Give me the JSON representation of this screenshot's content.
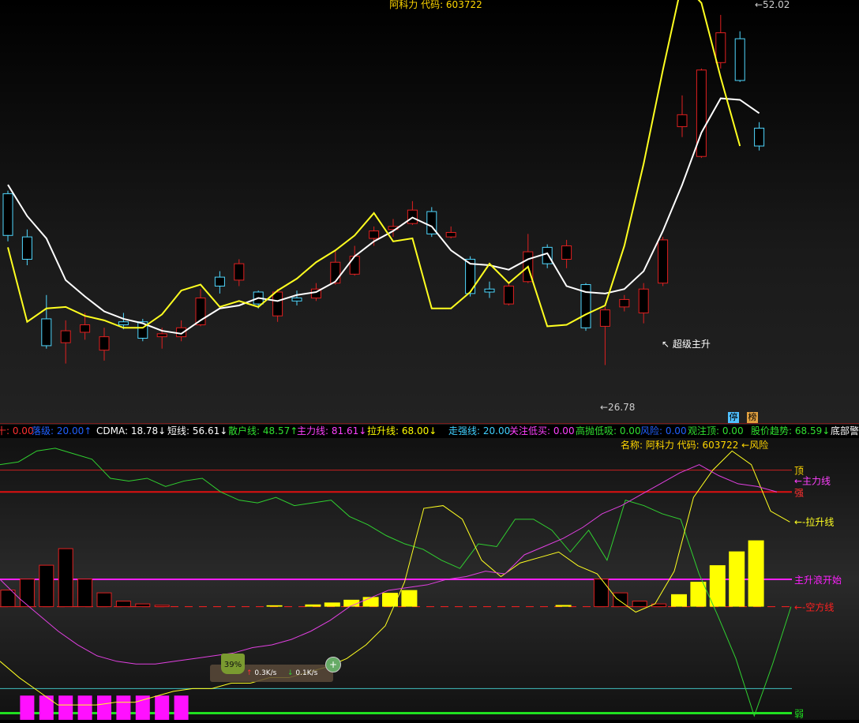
{
  "chart_data": [
    {
      "type": "candlestick",
      "title": "阿科力 代码: 603722",
      "ylim": [
        24.5,
        53
      ],
      "candles": [
        {
          "o": 37.2,
          "c": 40.0,
          "h": 40.2,
          "l": 36.8,
          "up": false
        },
        {
          "o": 35.6,
          "c": 37.1,
          "h": 37.6,
          "l": 35.2,
          "up": false
        },
        {
          "o": 31.6,
          "c": 29.8,
          "h": 33.2,
          "l": 29.6,
          "up": false
        },
        {
          "o": 30.0,
          "c": 30.8,
          "h": 31.5,
          "l": 28.6,
          "up": true
        },
        {
          "o": 30.7,
          "c": 31.2,
          "h": 32.0,
          "l": 30.2,
          "up": true
        },
        {
          "o": 29.5,
          "c": 30.4,
          "h": 31.0,
          "l": 28.8,
          "up": true
        },
        {
          "o": 31.2,
          "c": 31.4,
          "h": 32.0,
          "l": 30.9,
          "up": false
        },
        {
          "o": 31.4,
          "c": 30.3,
          "h": 31.6,
          "l": 30.1,
          "up": false
        },
        {
          "o": 30.4,
          "c": 30.6,
          "h": 31.0,
          "l": 29.6,
          "up": true
        },
        {
          "o": 30.4,
          "c": 31.0,
          "h": 31.5,
          "l": 30.1,
          "up": true
        },
        {
          "o": 31.2,
          "c": 33.0,
          "h": 33.6,
          "l": 31.1,
          "up": true
        },
        {
          "o": 34.4,
          "c": 33.8,
          "h": 34.8,
          "l": 33.3,
          "up": false
        },
        {
          "o": 34.2,
          "c": 35.3,
          "h": 35.6,
          "l": 33.8,
          "up": true
        },
        {
          "o": 33.4,
          "c": 32.6,
          "h": 33.5,
          "l": 32.3,
          "up": false
        },
        {
          "o": 31.8,
          "c": 33.4,
          "h": 33.6,
          "l": 31.4,
          "up": true
        },
        {
          "o": 33.0,
          "c": 32.8,
          "h": 33.5,
          "l": 32.5,
          "up": false
        },
        {
          "o": 33.0,
          "c": 33.6,
          "h": 34.0,
          "l": 32.8,
          "up": true
        },
        {
          "o": 34.0,
          "c": 35.4,
          "h": 36.2,
          "l": 33.9,
          "up": true
        },
        {
          "o": 34.6,
          "c": 35.8,
          "h": 36.5,
          "l": 34.5,
          "up": true
        },
        {
          "o": 37.0,
          "c": 37.5,
          "h": 37.8,
          "l": 36.5,
          "up": true
        },
        {
          "o": 37.6,
          "c": 37.8,
          "h": 38.3,
          "l": 37.1,
          "up": true
        },
        {
          "o": 38.0,
          "c": 38.9,
          "h": 39.5,
          "l": 37.9,
          "up": true
        },
        {
          "o": 38.8,
          "c": 37.3,
          "h": 39.1,
          "l": 37.1,
          "up": false
        },
        {
          "o": 37.1,
          "c": 37.4,
          "h": 37.8,
          "l": 37.0,
          "up": true
        },
        {
          "o": 35.6,
          "c": 33.3,
          "h": 35.8,
          "l": 33.1,
          "up": false
        },
        {
          "o": 33.4,
          "c": 33.6,
          "h": 34.1,
          "l": 33.0,
          "up": false
        },
        {
          "o": 32.6,
          "c": 33.8,
          "h": 34.1,
          "l": 32.5,
          "up": true
        },
        {
          "o": 34.1,
          "c": 36.1,
          "h": 37.3,
          "l": 34.0,
          "up": true
        },
        {
          "o": 36.4,
          "c": 35.3,
          "h": 36.6,
          "l": 35.0,
          "up": false
        },
        {
          "o": 35.6,
          "c": 36.5,
          "h": 36.9,
          "l": 35.0,
          "up": true
        },
        {
          "o": 33.9,
          "c": 31.0,
          "h": 34.0,
          "l": 30.8,
          "up": false
        },
        {
          "o": 31.1,
          "c": 32.2,
          "h": 32.4,
          "l": 28.5,
          "up": true
        },
        {
          "o": 32.4,
          "c": 32.9,
          "h": 33.2,
          "l": 32.1,
          "up": true
        },
        {
          "o": 32.0,
          "c": 33.6,
          "h": 34.0,
          "l": 31.3,
          "up": true
        },
        {
          "o": 34.0,
          "c": 36.9,
          "h": 37.1,
          "l": 33.8,
          "up": true
        },
        {
          "o": 44.5,
          "c": 45.3,
          "h": 46.6,
          "l": 43.8,
          "up": true
        },
        {
          "o": 42.5,
          "c": 48.3,
          "h": 48.4,
          "l": 42.4,
          "up": true
        },
        {
          "o": 50.8,
          "c": 48.8,
          "h": 52.0,
          "l": 48.4,
          "up": true
        },
        {
          "o": 47.6,
          "c": 50.4,
          "h": 50.9,
          "l": 47.5,
          "up": false
        },
        {
          "o": 44.4,
          "c": 43.2,
          "h": 44.8,
          "l": 42.9,
          "up": false
        }
      ],
      "ma_yellow": [
        36.4,
        31.4,
        32.3,
        32.4,
        31.8,
        31.5,
        31.0,
        31.0,
        31.9,
        33.5,
        33.9,
        32.4,
        32.8,
        32.4,
        33.5,
        34.3,
        35.4,
        36.2,
        37.2,
        38.7,
        36.8,
        37.0,
        32.3,
        32.3,
        33.4,
        35.3,
        34.0,
        35.1,
        31.1,
        31.2,
        31.9,
        32.5,
        36.5,
        42.0,
        48.3,
        54.2,
        52.8,
        47.8,
        43.2
      ],
      "ma_white": [
        40.6,
        38.5,
        37.0,
        34.2,
        33.1,
        32.1,
        31.6,
        31.3,
        30.8,
        30.6,
        31.5,
        32.3,
        32.5,
        33.0,
        32.8,
        33.2,
        33.4,
        34.1,
        35.8,
        36.8,
        37.5,
        38.4,
        37.8,
        36.2,
        35.3,
        35.2,
        34.9,
        35.6,
        36.0,
        33.8,
        33.4,
        33.3,
        33.6,
        34.8,
        37.5,
        40.6,
        44.1,
        46.4,
        46.3,
        45.4
      ],
      "annotations": {
        "high_label": "52.02",
        "low_label": "26.78",
        "signal_label": "超级主升"
      },
      "labels": {
        "stop": "停",
        "list": "榜"
      }
    },
    {
      "type": "indicator",
      "title": "名称: 阿科力 代码: 603722 ←风险",
      "ylim": [
        0,
        100
      ],
      "hlines": [
        {
          "name": "顶",
          "level": 90,
          "color": "#c82020"
        },
        {
          "name": "强",
          "level": 82,
          "color": "#e01010"
        },
        {
          "name": "主升浪开始",
          "level": 50,
          "color": "#ff20ff"
        },
        {
          "name": "空方线",
          "level": 40,
          "color": "#ff2020"
        },
        {
          "name": "",
          "level": 10,
          "color": "#40c0c0"
        },
        {
          "name": "弱",
          "level": 1,
          "color": "#20e020"
        }
      ],
      "line_labels": {
        "main": "主力线",
        "pull": "拉升线"
      },
      "bars_dark": [
        6,
        10,
        15,
        21,
        10,
        5,
        2,
        1,
        0.5
      ],
      "bars_dark_idx": [
        0,
        1,
        2,
        3,
        4,
        5,
        6,
        7,
        8
      ],
      "bars_dark2": [
        {
          "i": 31,
          "v": 10
        },
        {
          "i": 32,
          "v": 5
        },
        {
          "i": 33,
          "v": 2
        },
        {
          "i": 34,
          "v": 1
        }
      ],
      "bars_yellow": [
        {
          "i": 14,
          "v": 0.5
        },
        {
          "i": 16,
          "v": 0.8
        },
        {
          "i": 17,
          "v": 1.5
        },
        {
          "i": 18,
          "v": 2.5
        },
        {
          "i": 19,
          "v": 3.5
        },
        {
          "i": 20,
          "v": 5
        },
        {
          "i": 21,
          "v": 6
        },
        {
          "i": 29,
          "v": 0.6
        },
        {
          "i": 35,
          "v": 4.5
        },
        {
          "i": 36,
          "v": 9
        },
        {
          "i": 37,
          "v": 15
        },
        {
          "i": 38,
          "v": 20
        },
        {
          "i": 39,
          "v": 24
        }
      ],
      "bars_magenta": [
        {
          "i": 1,
          "v": 7
        },
        {
          "i": 2,
          "v": 7
        },
        {
          "i": 3,
          "v": 7
        },
        {
          "i": 4,
          "v": 7
        },
        {
          "i": 5,
          "v": 7
        },
        {
          "i": 6,
          "v": 7
        },
        {
          "i": 7,
          "v": 7
        },
        {
          "i": 8,
          "v": 7
        },
        {
          "i": 9,
          "v": 7
        }
      ],
      "green_line": [
        92,
        93,
        97,
        98,
        96,
        94,
        87,
        86,
        87,
        84,
        86,
        87,
        82,
        79,
        78,
        80,
        77,
        78,
        79,
        73,
        70,
        66,
        63,
        61,
        57,
        54,
        63,
        62,
        72,
        72,
        68,
        60,
        68,
        57,
        79,
        77,
        74,
        72,
        52,
        37,
        21,
        0,
        19,
        40
      ],
      "yellow_line": [
        20,
        14,
        9,
        4,
        4,
        4,
        5,
        5,
        7,
        9,
        10,
        10,
        12,
        12,
        14,
        14,
        16,
        18,
        21,
        26,
        33,
        49,
        76,
        77,
        72,
        57,
        51,
        56,
        58,
        60,
        55,
        52,
        43,
        38,
        41,
        53,
        80,
        90,
        97,
        92,
        75,
        71
      ],
      "magenta_line": [
        50,
        43,
        37,
        31,
        26,
        22,
        20,
        19,
        19,
        20,
        21,
        22,
        23,
        25,
        26,
        28,
        31,
        35,
        40,
        43,
        46,
        47,
        48,
        50,
        51,
        53,
        52,
        59,
        62,
        65,
        69,
        74,
        77,
        81,
        85,
        89,
        92,
        88,
        85,
        84,
        82
      ]
    }
  ],
  "status": [
    {
      "text": "十: 0.00",
      "color": "#ff3030"
    },
    {
      "text": "落级: 20.00↑",
      "color": "#2060ff"
    },
    {
      "text": "CDMA: 18.78↓",
      "color": "#ffffff"
    },
    {
      "text": "短线: 56.61↓",
      "color": "#ffffff"
    },
    {
      "text": "散户线: 48.57↑",
      "color": "#30e030"
    },
    {
      "text": "主力线: 81.61↓",
      "color": "#ff40ff"
    },
    {
      "text": "拉升线: 68.00↓",
      "color": "#ffff00"
    },
    {
      "text": "走强线: 20.00",
      "color": "#40d0ff"
    },
    {
      "text": "关注低买: 0.00",
      "color": "#ff40ff"
    },
    {
      "text": "高抛低吸: 0.00",
      "color": "#30e030"
    },
    {
      "text": "风险: 0.00",
      "color": "#2060ff"
    },
    {
      "text": "观注顶: 0.00",
      "color": "#30e030"
    },
    {
      "text": "股价趋势: 68.59↓",
      "color": "#30e030"
    },
    {
      "text": "底部警",
      "color": "#ffffff"
    }
  ],
  "net_widget": {
    "percent": "39%",
    "up": "0.3K/s",
    "down": "0.1K/s",
    "up_arrow": "↑",
    "down_arrow": "↓",
    "plus": "+"
  }
}
